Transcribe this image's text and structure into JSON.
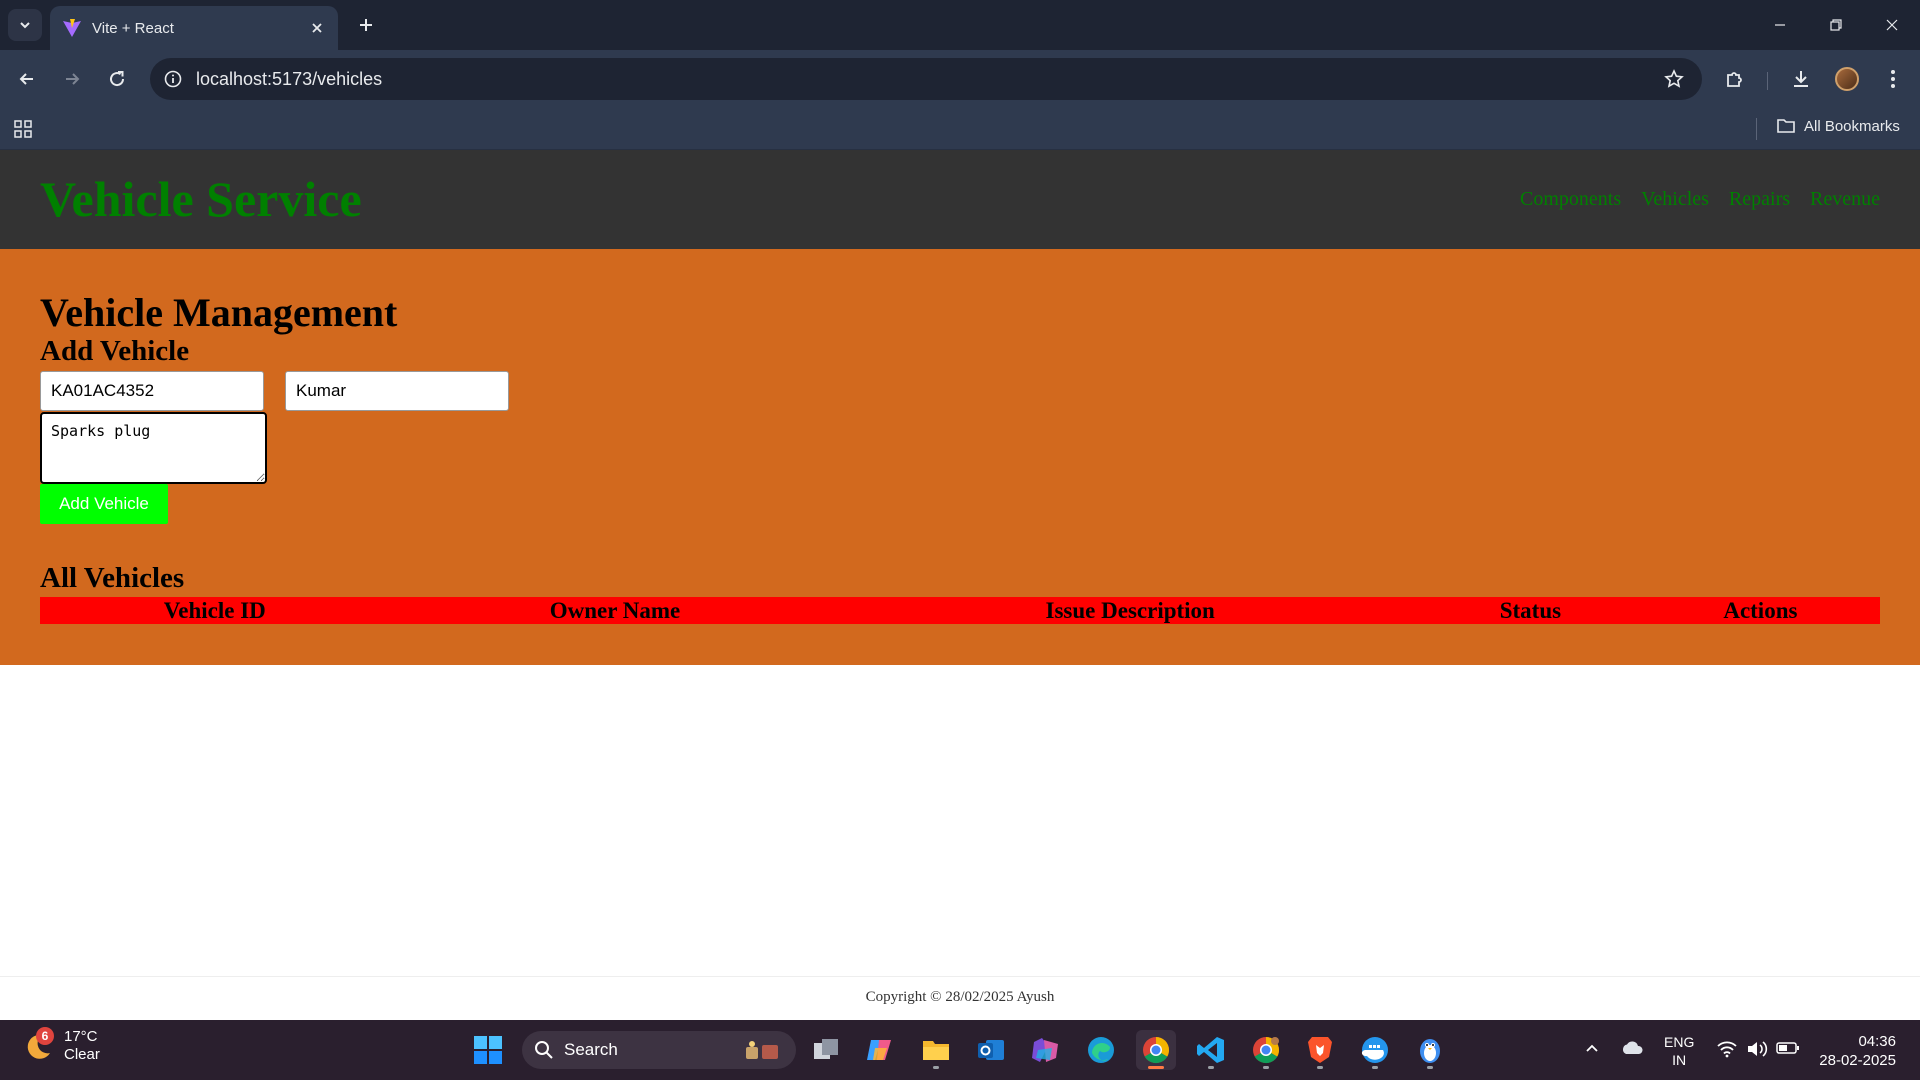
{
  "browser": {
    "tab_title": "Vite + React",
    "url": "localhost:5173/vehicles",
    "bookmarks_label": "All Bookmarks",
    "accent_color": "#2f3a4f"
  },
  "header": {
    "brand": "Vehicle Service",
    "nav": [
      "Components",
      "Vehicles",
      "Repairs",
      "Revenue"
    ],
    "brand_color": "#008000"
  },
  "main": {
    "title": "Vehicle Management",
    "background_color": "#d2691e",
    "form": {
      "title": "Add Vehicle",
      "vehicle_id_value": "KA01AC4352",
      "owner_name_value": "Kumar",
      "issue_value": "Sparks plug",
      "submit_label": "Add Vehicle",
      "submit_color": "#00ff00"
    },
    "list": {
      "title": "All Vehicles",
      "columns": [
        "Vehicle ID",
        "Owner Name",
        "Issue Description",
        "Status",
        "Actions"
      ],
      "header_color": "#ff0000"
    }
  },
  "footer": {
    "text": "Copyright © 28/02/2025 Ayush"
  },
  "taskbar": {
    "weather_badge": "6",
    "temperature": "17°C",
    "condition": "Clear",
    "search_label": "Search",
    "apps": [
      "task-view",
      "copilot",
      "file-explorer",
      "outlook",
      "microsoft-365",
      "edge",
      "chrome",
      "vscode",
      "chrome-profile",
      "brave",
      "docker",
      "penguin-app"
    ],
    "language": "ENG",
    "region": "IN",
    "time": "04:36",
    "date": "28-02-2025"
  }
}
